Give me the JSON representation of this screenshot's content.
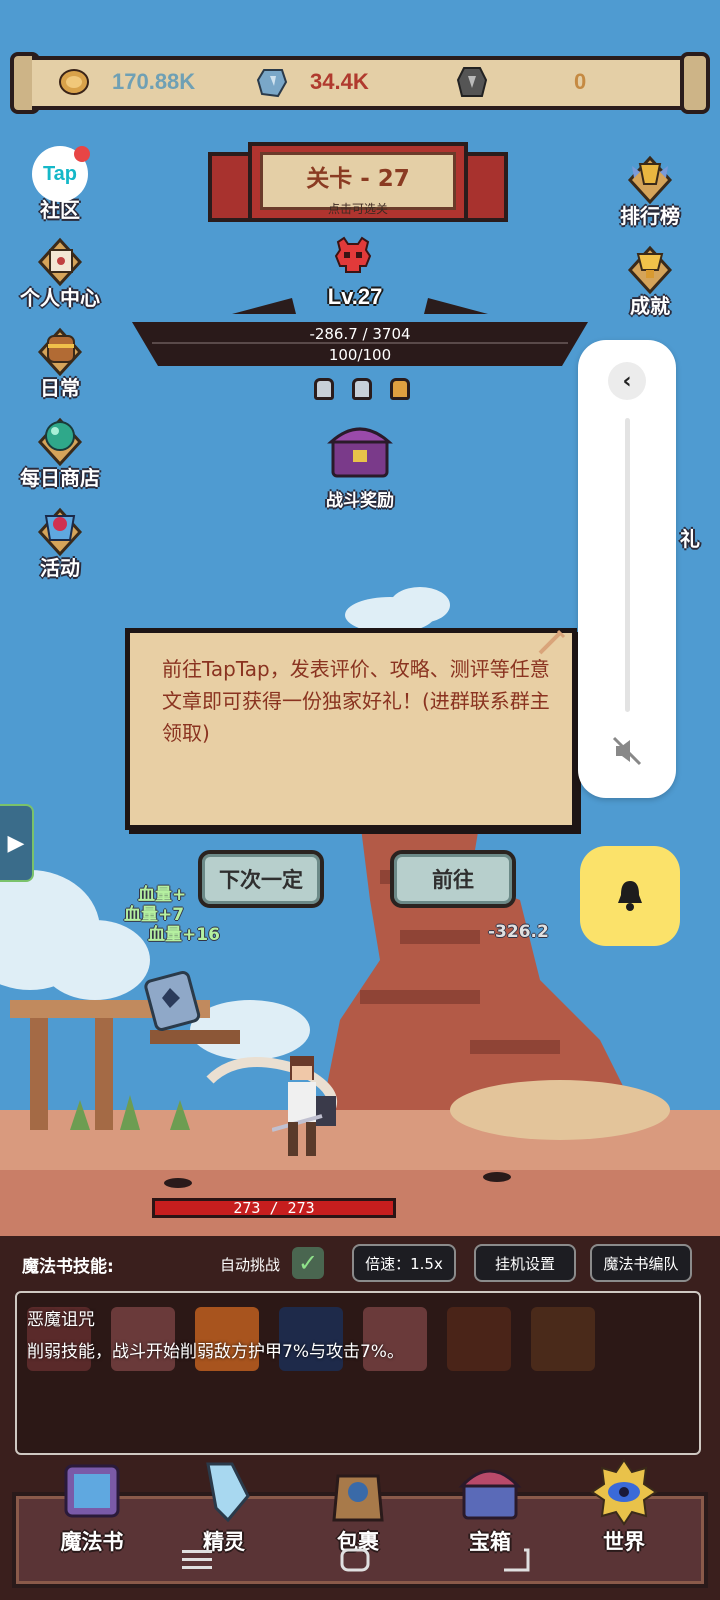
{
  "currencies": [
    {
      "icon": "coin-icon",
      "value": "170.88K",
      "color": "#6fa0b4"
    },
    {
      "icon": "crystal-icon",
      "value": "34.4K",
      "color": "#b03a2e"
    },
    {
      "icon": "rune-stone-icon",
      "value": "0",
      "color": "#c58a42"
    }
  ],
  "stage": {
    "title": "关卡 - 27",
    "subtitle": "点击可选关"
  },
  "left_menu": [
    {
      "label": "社区",
      "badge": "Tap"
    },
    {
      "label": "个人中心"
    },
    {
      "label": "日常"
    },
    {
      "label": "每日商店"
    },
    {
      "label": "活动"
    }
  ],
  "right_menu": [
    {
      "label": "排行榜"
    },
    {
      "label": "成就"
    },
    {
      "label": "礼"
    }
  ],
  "boss": {
    "level": "Lv.27",
    "hp_text": "-286.7 / 3704",
    "shield_text": "100/100",
    "reward_label": "战斗奖励"
  },
  "popup": {
    "text": "前往TapTap，发表评价、攻略、测评等任意文章即可获得一份独家好礼！(进群联系群主领取)",
    "cancel_label": "下次一定",
    "confirm_label": "前往"
  },
  "floats": [
    "血量+",
    "血量+7",
    "血量+16",
    "-326.2"
  ],
  "hero": {
    "hp_text": "273 / 273"
  },
  "skill_bar": {
    "title": "魔法书技能:",
    "auto_label": "自动挑战",
    "speed_label": "倍速：1.5x",
    "idle_label": "挂机设置",
    "team_label": "魔法书编队"
  },
  "skill_info": {
    "name": "恶魔诅咒",
    "desc": "削弱技能，战斗开始削弱敌方护甲7%与攻击7%。"
  },
  "bottom_nav": [
    {
      "label": "魔法书",
      "icon": "spellbook-icon"
    },
    {
      "label": "精灵",
      "icon": "spirit-crystal-icon"
    },
    {
      "label": "包裹",
      "icon": "backpack-icon"
    },
    {
      "label": "宝箱",
      "icon": "treasure-chest-icon"
    },
    {
      "label": "世界",
      "icon": "world-eye-icon"
    }
  ],
  "overlay": {
    "back_glyph": "‹"
  },
  "colors": {
    "sky": "#4f9bd1",
    "parchment": "#e8cfa4",
    "popup_text": "#8a3320",
    "notification_yellow": "#fbe26a"
  }
}
